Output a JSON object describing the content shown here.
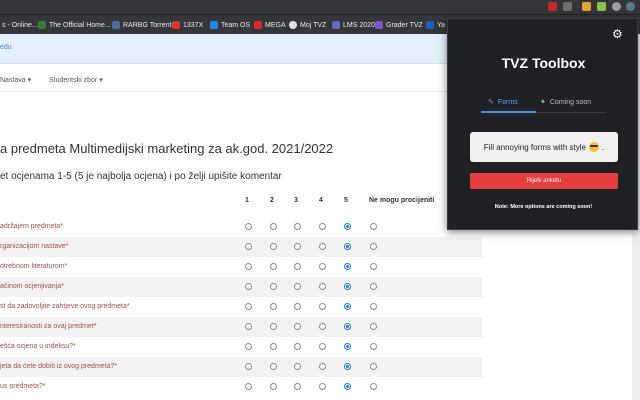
{
  "browser": {
    "bookmarks": [
      {
        "label": "s - Online...",
        "icon": "page-icon"
      },
      {
        "label": "The Official Home...",
        "icon": "page-icon"
      },
      {
        "label": "RARBG Torrents",
        "icon": "page-icon"
      },
      {
        "label": "1337X",
        "icon": "page-icon"
      },
      {
        "label": "Team OS",
        "icon": "page-icon"
      },
      {
        "label": "MEGA",
        "icon": "mega-icon"
      },
      {
        "label": "Moj TVZ",
        "icon": "page-icon"
      },
      {
        "label": "LMS 2020",
        "icon": "page-icon"
      },
      {
        "label": "Grader TVZ",
        "icon": "page-icon"
      },
      {
        "label": "Ya",
        "icon": "page-icon"
      }
    ]
  },
  "page": {
    "brand": "edu",
    "nav": [
      "Nastava ▾",
      "Studentski zbor ▾"
    ],
    "title": "a predmeta Multimedijski marketing za ak.god. 2021/2022",
    "subtitle": "et ocjenama 1-5 (5 je najbolja ocjena) i po želji upišite komentar",
    "columns": [
      "1",
      "2",
      "3",
      "4",
      "5",
      "Ne mogu procijeniti"
    ],
    "questions": [
      {
        "label": "adržajem predmeta*",
        "selected": 5
      },
      {
        "label": "rganizacijom nastave*",
        "selected": 5
      },
      {
        "label": "otrebnom literaturom*",
        "selected": 5
      },
      {
        "label": "ačinom ocjenjivanja*",
        "selected": 5
      },
      {
        "label": "st da zadovoljite zahtjeve ovog predmeta*",
        "selected": 5
      },
      {
        "label": "nteresiranosti za ovaj predmet*",
        "selected": 5
      },
      {
        "label": "ešća ocjena u indeksu?*",
        "selected": 5
      },
      {
        "label": "jeta da ćete dobiti iz ovog predmeta?*",
        "selected": 5
      },
      {
        "label": "us predmeta?*",
        "selected": 5
      }
    ]
  },
  "extension": {
    "title": "TVZ Toolbox",
    "tabs": [
      {
        "label": "Forms",
        "active": true,
        "icon": "pencil-icon"
      },
      {
        "label": "Coming soon",
        "active": false,
        "icon": "sparkle-icon"
      }
    ],
    "card_text": "Fill annoying forms with style",
    "solve_button": "Riješi anketu",
    "note": "Note: More options are coming soon!",
    "colors": {
      "accent": "#4a90e2",
      "button": "#e53e3e",
      "background": "#202124"
    }
  }
}
